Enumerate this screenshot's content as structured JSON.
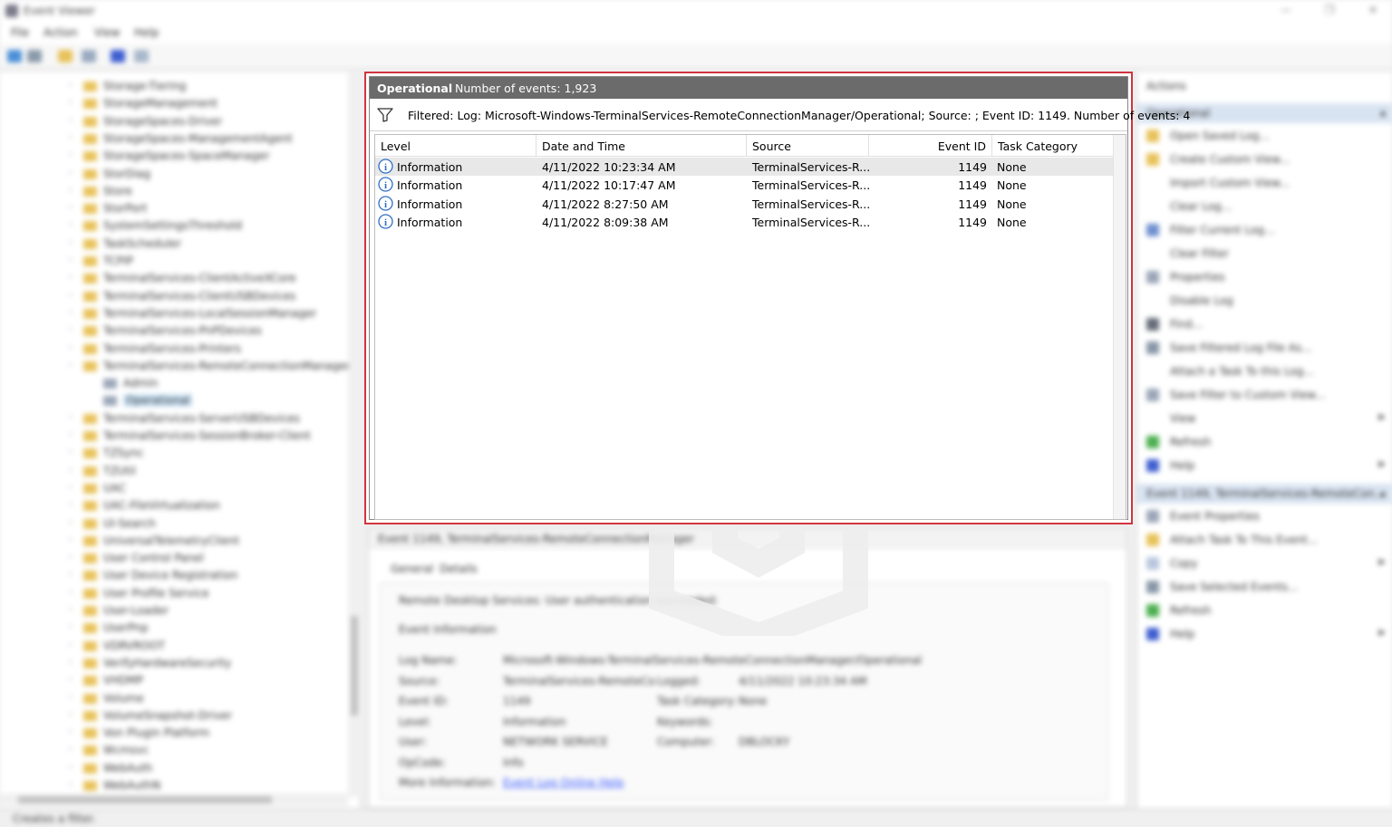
{
  "window": {
    "title": "Event Viewer",
    "menu": [
      "File",
      "Action",
      "View",
      "Help"
    ]
  },
  "tree": {
    "items": [
      {
        "label": "Storage-Tiering",
        "depth": 1
      },
      {
        "label": "StorageManagement",
        "depth": 1
      },
      {
        "label": "StorageSpaces-Driver",
        "depth": 1
      },
      {
        "label": "StorageSpaces-ManagementAgent",
        "depth": 1
      },
      {
        "label": "StorageSpaces-SpaceManager",
        "depth": 1
      },
      {
        "label": "StorDiag",
        "depth": 1
      },
      {
        "label": "Store",
        "depth": 1
      },
      {
        "label": "StorPort",
        "depth": 1
      },
      {
        "label": "SystemSettingsThreshold",
        "depth": 1
      },
      {
        "label": "TaskScheduler",
        "depth": 1
      },
      {
        "label": "TCPIP",
        "depth": 1
      },
      {
        "label": "TerminalServices-ClientActiveXCore",
        "depth": 1
      },
      {
        "label": "TerminalServices-ClientUSBDevices",
        "depth": 1
      },
      {
        "label": "TerminalServices-LocalSessionManager",
        "depth": 1
      },
      {
        "label": "TerminalServices-PnPDevices",
        "depth": 1
      },
      {
        "label": "TerminalServices-Printers",
        "depth": 1
      },
      {
        "label": "TerminalServices-RemoteConnectionManager",
        "depth": 1
      },
      {
        "label": "Admin",
        "depth": 2
      },
      {
        "label": "Operational",
        "depth": 2,
        "selected": true
      },
      {
        "label": "TerminalServices-ServerUSBDevices",
        "depth": 1
      },
      {
        "label": "TerminalServices-SessionBroker-Client",
        "depth": 1
      },
      {
        "label": "TZSync",
        "depth": 1
      },
      {
        "label": "TZUtil",
        "depth": 1
      },
      {
        "label": "UAC",
        "depth": 1
      },
      {
        "label": "UAC-FileVirtualization",
        "depth": 1
      },
      {
        "label": "UI-Search",
        "depth": 1
      },
      {
        "label": "UniversalTelemetryClient",
        "depth": 1
      },
      {
        "label": "User Control Panel",
        "depth": 1
      },
      {
        "label": "User Device Registration",
        "depth": 1
      },
      {
        "label": "User Profile Service",
        "depth": 1
      },
      {
        "label": "User-Loader",
        "depth": 1
      },
      {
        "label": "UserPnp",
        "depth": 1
      },
      {
        "label": "VDRVROOT",
        "depth": 1
      },
      {
        "label": "VerifyHardwareSecurity",
        "depth": 1
      },
      {
        "label": "VHDMP",
        "depth": 1
      },
      {
        "label": "Volume",
        "depth": 1
      },
      {
        "label": "VolumeSnapshot-Driver",
        "depth": 1
      },
      {
        "label": "Von Plugin Platform",
        "depth": 1
      },
      {
        "label": "Wcmsvc",
        "depth": 1
      },
      {
        "label": "WebAuth",
        "depth": 1
      },
      {
        "label": "WebAuthN",
        "depth": 1
      }
    ]
  },
  "events_panel": {
    "log_name": "Operational",
    "event_count": "Number of events: 1,923",
    "filter_text": "Filtered: Log: Microsoft-Windows-TerminalServices-RemoteConnectionManager/Operational; Source: ; Event ID: 1149. Number of events: 4",
    "columns": [
      "Level",
      "Date and Time",
      "Source",
      "Event ID",
      "Task Category"
    ],
    "rows": [
      {
        "level": "Information",
        "datetime": "4/11/2022 10:23:34 AM",
        "source": "TerminalServices-R...",
        "event_id": "1149",
        "task": "None"
      },
      {
        "level": "Information",
        "datetime": "4/11/2022 10:17:47 AM",
        "source": "TerminalServices-R...",
        "event_id": "1149",
        "task": "None"
      },
      {
        "level": "Information",
        "datetime": "4/11/2022 8:27:50 AM",
        "source": "TerminalServices-R...",
        "event_id": "1149",
        "task": "None"
      },
      {
        "level": "Information",
        "datetime": "4/11/2022 8:09:38 AM",
        "source": "TerminalServices-R...",
        "event_id": "1149",
        "task": "None"
      }
    ]
  },
  "details": {
    "header": "Event 1149, TerminalServices-RemoteConnectionManager",
    "tabs": [
      "General",
      "Details"
    ],
    "message": "Remote Desktop Services: User authentication succeeded:",
    "event_info": "Event Information",
    "fields": [
      {
        "k": "Log Name:",
        "v": "Microsoft-Windows-TerminalServices-RemoteConnectionManager/Operational"
      },
      {
        "k": "Source:",
        "v": "TerminalServices-RemoteCo",
        "k2": "Logged:",
        "v2": "4/11/2022 10:23:34 AM"
      },
      {
        "k": "Event ID:",
        "v": "1149",
        "k2": "Task Category:",
        "v2": "None"
      },
      {
        "k": "Level:",
        "v": "Information",
        "k2": "Keywords:",
        "v2": ""
      },
      {
        "k": "User:",
        "v": "NETWORK SERVICE",
        "k2": "Computer:",
        "v2": "DBLOCKY"
      },
      {
        "k": "OpCode:",
        "v": "Info"
      },
      {
        "k": "More Information:",
        "v": "Event Log Online Help",
        "link": true
      }
    ]
  },
  "actions": {
    "section1": "Operational",
    "items1": [
      {
        "label": "Open Saved Log...",
        "color": "#e8c25a"
      },
      {
        "label": "Create Custom View...",
        "color": "#e8c25a"
      },
      {
        "label": "Import Custom View...",
        "color": "#ffffff"
      },
      {
        "label": "Clear Log...",
        "color": "#ffffff"
      },
      {
        "label": "Filter Current Log...",
        "color": "#6f8fcf"
      },
      {
        "label": "Clear Filter",
        "color": "#ffffff"
      },
      {
        "label": "Properties",
        "color": "#9aa6b8"
      },
      {
        "label": "Disable Log",
        "color": "#ffffff"
      },
      {
        "label": "Find...",
        "color": "#666c78"
      },
      {
        "label": "Save Filtered Log File As...",
        "color": "#8896a8"
      },
      {
        "label": "Attach a Task To this Log...",
        "color": "#ffffff"
      },
      {
        "label": "Save Filter to Custom View...",
        "color": "#9aa6b8"
      },
      {
        "label": "View",
        "color": "#ffffff",
        "sub": true
      },
      {
        "label": "Refresh",
        "color": "#4caf50"
      },
      {
        "label": "Help",
        "color": "#3f5fd0",
        "sub": true
      }
    ],
    "section2": "Event 1149, TerminalServices-RemoteCon...",
    "items2": [
      {
        "label": "Event Properties",
        "color": "#9aa6b8"
      },
      {
        "label": "Attach Task To This Event...",
        "color": "#e8c25a"
      },
      {
        "label": "Copy",
        "color": "#b8c6de",
        "sub": true
      },
      {
        "label": "Save Selected Events...",
        "color": "#8896a8"
      },
      {
        "label": "Refresh",
        "color": "#4caf50"
      },
      {
        "label": "Help",
        "color": "#3f5fd0",
        "sub": true
      }
    ]
  },
  "status": {
    "text": "Creates a filter."
  },
  "colors": {
    "highlight_border": "#d1343f",
    "panel_header": "#6b6b6b",
    "info_icon": "#2f6fc8"
  }
}
